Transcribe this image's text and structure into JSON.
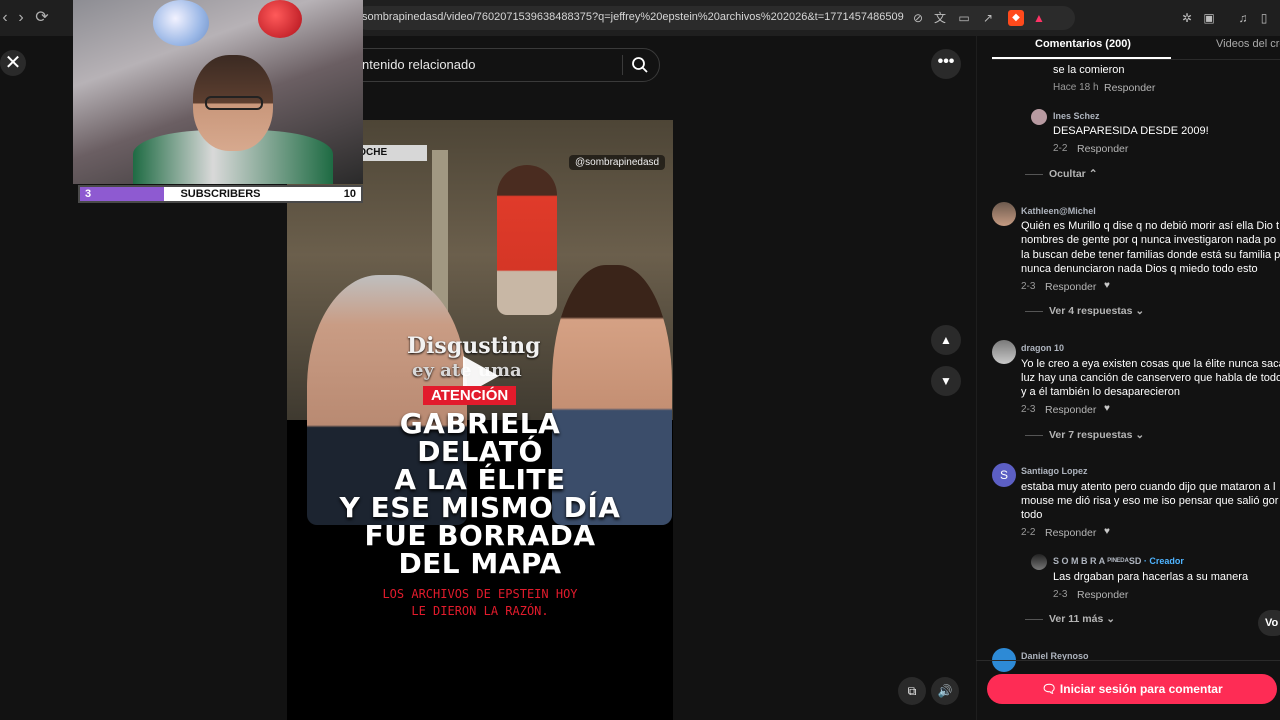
{
  "browser": {
    "url": "sombrapinedasd/video/7602071539638488375?q=jeffrey%20epstein%20archivos%202026&t=1771457486509",
    "icons": [
      "back-icon",
      "forward-icon",
      "reload-icon",
      "translate-icon",
      "cast-icon",
      "share-icon",
      "brave-shield-icon",
      "rewards-icon",
      "extensions-icon",
      "media-icon",
      "sidebar-icon"
    ]
  },
  "overlay": {
    "subscribers": {
      "current": "3",
      "label": "SUBSCRIBERS",
      "goal": "10",
      "fill_fraction": 0.3
    }
  },
  "search": {
    "placeholder": "ntenido relacionado"
  },
  "video": {
    "watermark": "@sombrapinedasd",
    "sign": "NOCHE",
    "overlay_line1": "Disgusting",
    "overlay_line2": "ey ate  uma",
    "badge": "ATENCIÓN",
    "headline": [
      "GABRIELA",
      "DELATÓ",
      "A LA ÉLITE",
      "Y ESE MISMO DÍA",
      "FUE BORRADA",
      "DEL MAPA"
    ],
    "subline": [
      "LOS ARCHIVOS DE EPSTEIN HOY",
      "LE DIERON LA RAZÓN."
    ]
  },
  "panel": {
    "tabs": {
      "comments": "Comentarios (200)",
      "videos": "Videos del cre"
    },
    "reply_label": "Responder",
    "comments": [
      {
        "text": "se la comieron",
        "meta": "Hace 18 h"
      },
      {
        "name": "Ines Schez",
        "text": "DESAPARESIDA DESDE 2009!",
        "meta": "2-2"
      },
      {
        "toggle": "Ocultar"
      },
      {
        "name": "Kathleen@Michel",
        "lines": [
          "Quién es Murillo q dise q no debió morir así ella Dio t",
          "nombres de gente por q nunca investigaron nada po",
          "la buscan debe tener familias donde está su familia p",
          "nunca denunciaron nada Dios q miedo todo esto"
        ],
        "meta": "2-3",
        "toggle": "Ver 4 respuestas"
      },
      {
        "name": "dragon 10",
        "lines": [
          "Yo le creo a eya existen cosas que la élite nunca saca",
          "luz hay una canción de canservero que habla de todo",
          "y a él también lo desaparecieron"
        ],
        "meta": "2-3",
        "toggle": "Ver 7 respuestas"
      },
      {
        "name": "Santiago Lopez",
        "avatar_letter": "S",
        "lines": [
          "estaba muy atento pero cuando dijo que mataron a l",
          "mouse me dió risa y eso me iso pensar que salió gor",
          "todo"
        ],
        "meta": "2-2"
      },
      {
        "name": "S O M B R A ᴾᴵᴺᴱᴰᴬSD",
        "creator_label": "· Creador",
        "text": "Las drgaban para hacerlas a su manera",
        "meta": "2-3",
        "toggle": "Ver 11 más"
      },
      {
        "name": "Daniel Reynoso"
      }
    ],
    "vo_button": "Vo",
    "login_button": "Iniciar sesión para comentar"
  },
  "colors": {
    "accent": "#fe2c55",
    "creator": "#4fb4ff",
    "progress": "#8e5ad1"
  }
}
